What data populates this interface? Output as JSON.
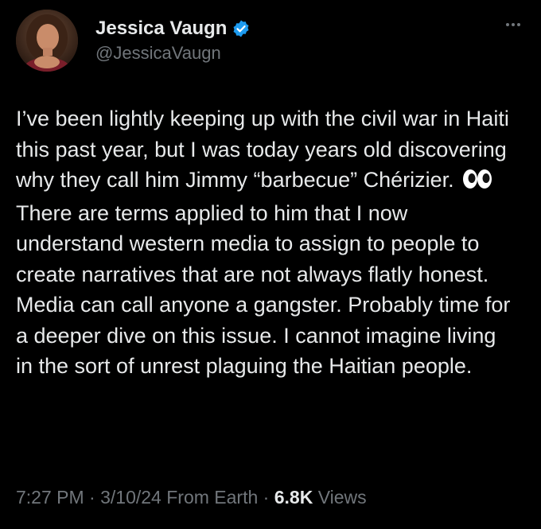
{
  "author": {
    "display_name": "Jessica Vaugn",
    "handle": "@JessicaVaugn",
    "verified_icon": "verified-badge-icon",
    "accent_color": "#1d9bf0"
  },
  "tweet": {
    "paragraph_1": "I’ve been lightly keeping up with the civil war in Haiti this past year, but I was today years old discovering why they call him Jimmy “barbecue” Chérizier.",
    "emoji_icon": "eyes-icon",
    "paragraph_2": "There are terms applied to him that I now understand western media to assign to people to create narratives that are not always flatly honest. Media can call anyone a gangster. Probably time for a deeper dive on this issue. I cannot imagine living in the sort of unrest plaguing the Haitian people."
  },
  "meta": {
    "time": "7:27 PM",
    "separator": " · ",
    "date": "3/10/24",
    "location": "From Earth",
    "views_count": "6.8K",
    "views_label": "Views"
  }
}
